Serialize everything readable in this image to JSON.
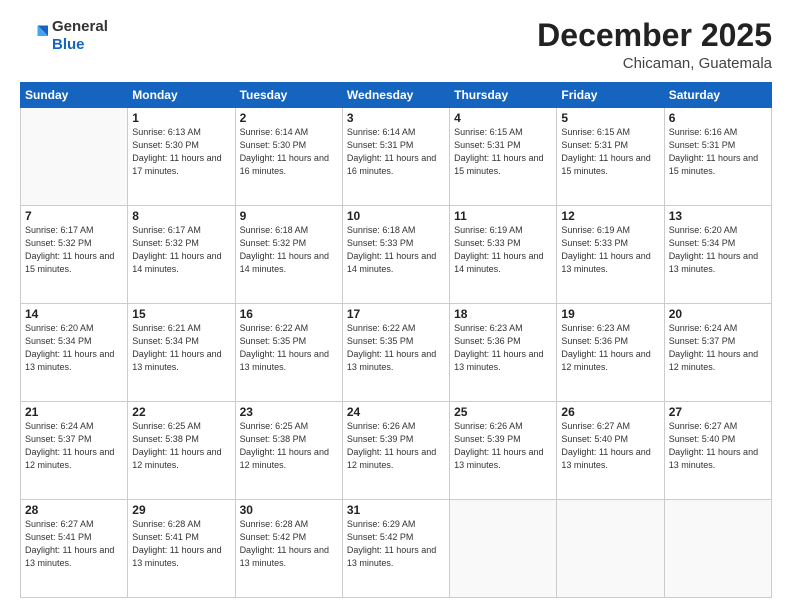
{
  "logo": {
    "general": "General",
    "blue": "Blue"
  },
  "header": {
    "month_year": "December 2025",
    "location": "Chicaman, Guatemala"
  },
  "weekdays": [
    "Sunday",
    "Monday",
    "Tuesday",
    "Wednesday",
    "Thursday",
    "Friday",
    "Saturday"
  ],
  "weeks": [
    [
      {
        "day": null
      },
      {
        "day": 1,
        "sunrise": "6:13 AM",
        "sunset": "5:30 PM",
        "daylight": "11 hours and 17 minutes."
      },
      {
        "day": 2,
        "sunrise": "6:14 AM",
        "sunset": "5:30 PM",
        "daylight": "11 hours and 16 minutes."
      },
      {
        "day": 3,
        "sunrise": "6:14 AM",
        "sunset": "5:31 PM",
        "daylight": "11 hours and 16 minutes."
      },
      {
        "day": 4,
        "sunrise": "6:15 AM",
        "sunset": "5:31 PM",
        "daylight": "11 hours and 15 minutes."
      },
      {
        "day": 5,
        "sunrise": "6:15 AM",
        "sunset": "5:31 PM",
        "daylight": "11 hours and 15 minutes."
      },
      {
        "day": 6,
        "sunrise": "6:16 AM",
        "sunset": "5:31 PM",
        "daylight": "11 hours and 15 minutes."
      }
    ],
    [
      {
        "day": 7,
        "sunrise": "6:17 AM",
        "sunset": "5:32 PM",
        "daylight": "11 hours and 15 minutes."
      },
      {
        "day": 8,
        "sunrise": "6:17 AM",
        "sunset": "5:32 PM",
        "daylight": "11 hours and 14 minutes."
      },
      {
        "day": 9,
        "sunrise": "6:18 AM",
        "sunset": "5:32 PM",
        "daylight": "11 hours and 14 minutes."
      },
      {
        "day": 10,
        "sunrise": "6:18 AM",
        "sunset": "5:33 PM",
        "daylight": "11 hours and 14 minutes."
      },
      {
        "day": 11,
        "sunrise": "6:19 AM",
        "sunset": "5:33 PM",
        "daylight": "11 hours and 14 minutes."
      },
      {
        "day": 12,
        "sunrise": "6:19 AM",
        "sunset": "5:33 PM",
        "daylight": "11 hours and 13 minutes."
      },
      {
        "day": 13,
        "sunrise": "6:20 AM",
        "sunset": "5:34 PM",
        "daylight": "11 hours and 13 minutes."
      }
    ],
    [
      {
        "day": 14,
        "sunrise": "6:20 AM",
        "sunset": "5:34 PM",
        "daylight": "11 hours and 13 minutes."
      },
      {
        "day": 15,
        "sunrise": "6:21 AM",
        "sunset": "5:34 PM",
        "daylight": "11 hours and 13 minutes."
      },
      {
        "day": 16,
        "sunrise": "6:22 AM",
        "sunset": "5:35 PM",
        "daylight": "11 hours and 13 minutes."
      },
      {
        "day": 17,
        "sunrise": "6:22 AM",
        "sunset": "5:35 PM",
        "daylight": "11 hours and 13 minutes."
      },
      {
        "day": 18,
        "sunrise": "6:23 AM",
        "sunset": "5:36 PM",
        "daylight": "11 hours and 13 minutes."
      },
      {
        "day": 19,
        "sunrise": "6:23 AM",
        "sunset": "5:36 PM",
        "daylight": "11 hours and 12 minutes."
      },
      {
        "day": 20,
        "sunrise": "6:24 AM",
        "sunset": "5:37 PM",
        "daylight": "11 hours and 12 minutes."
      }
    ],
    [
      {
        "day": 21,
        "sunrise": "6:24 AM",
        "sunset": "5:37 PM",
        "daylight": "11 hours and 12 minutes."
      },
      {
        "day": 22,
        "sunrise": "6:25 AM",
        "sunset": "5:38 PM",
        "daylight": "11 hours and 12 minutes."
      },
      {
        "day": 23,
        "sunrise": "6:25 AM",
        "sunset": "5:38 PM",
        "daylight": "11 hours and 12 minutes."
      },
      {
        "day": 24,
        "sunrise": "6:26 AM",
        "sunset": "5:39 PM",
        "daylight": "11 hours and 12 minutes."
      },
      {
        "day": 25,
        "sunrise": "6:26 AM",
        "sunset": "5:39 PM",
        "daylight": "11 hours and 13 minutes."
      },
      {
        "day": 26,
        "sunrise": "6:27 AM",
        "sunset": "5:40 PM",
        "daylight": "11 hours and 13 minutes."
      },
      {
        "day": 27,
        "sunrise": "6:27 AM",
        "sunset": "5:40 PM",
        "daylight": "11 hours and 13 minutes."
      }
    ],
    [
      {
        "day": 28,
        "sunrise": "6:27 AM",
        "sunset": "5:41 PM",
        "daylight": "11 hours and 13 minutes."
      },
      {
        "day": 29,
        "sunrise": "6:28 AM",
        "sunset": "5:41 PM",
        "daylight": "11 hours and 13 minutes."
      },
      {
        "day": 30,
        "sunrise": "6:28 AM",
        "sunset": "5:42 PM",
        "daylight": "11 hours and 13 minutes."
      },
      {
        "day": 31,
        "sunrise": "6:29 AM",
        "sunset": "5:42 PM",
        "daylight": "11 hours and 13 minutes."
      },
      {
        "day": null
      },
      {
        "day": null
      },
      {
        "day": null
      }
    ]
  ]
}
